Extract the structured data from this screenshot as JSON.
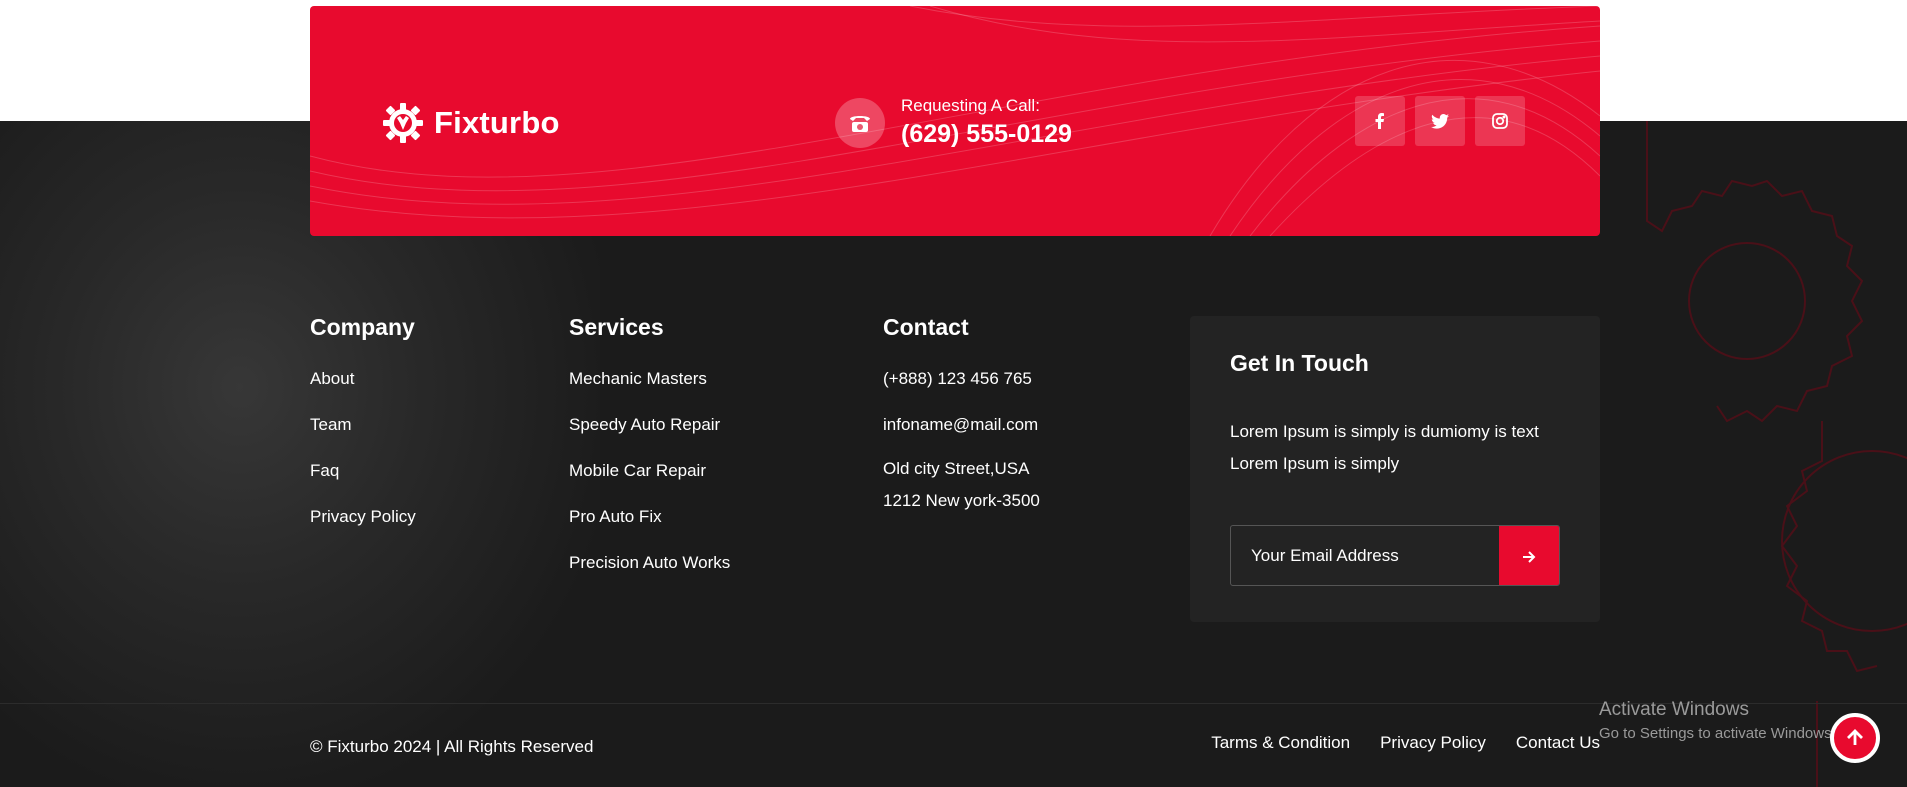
{
  "brand": {
    "name": "Fixturbo"
  },
  "cta": {
    "call_label": "Requesting A Call:",
    "call_number": "(629) 555-0129",
    "socials": [
      {
        "icon": "facebook-icon",
        "glyph": "f"
      },
      {
        "icon": "twitter-icon",
        "glyph": ""
      },
      {
        "icon": "instagram-icon",
        "glyph": ""
      }
    ]
  },
  "company": {
    "title": "Company",
    "links": [
      "About",
      "Team",
      "Faq",
      "Privacy Policy"
    ]
  },
  "services": {
    "title": "Services",
    "links": [
      "Mechanic Masters",
      "Speedy Auto Repair",
      "Mobile Car Repair",
      "Pro Auto Fix",
      "Precision Auto Works"
    ]
  },
  "contact": {
    "title": "Contact",
    "phone": "(+888) 123 456 765",
    "email": "infoname@mail.com",
    "address_line1": "Old city Street,USA",
    "address_line2": "1212 New york-3500"
  },
  "touch": {
    "title": "Get In Touch",
    "text": "Lorem Ipsum is simply is dumiomy is text Lorem Ipsum is simply",
    "email_placeholder": "Your Email Address"
  },
  "bottom": {
    "copyright": "© Fixturbo 2024 | All Rights Reserved",
    "links": [
      "Tarms & Condition",
      "Privacy Policy",
      "Contact Us"
    ]
  },
  "watermark": {
    "line1": "Activate Windows",
    "line2": "Go to Settings to activate Windows."
  },
  "colors": {
    "accent": "#e80a2e",
    "footer_bg": "#1b1b1b",
    "panel": "#232323"
  }
}
